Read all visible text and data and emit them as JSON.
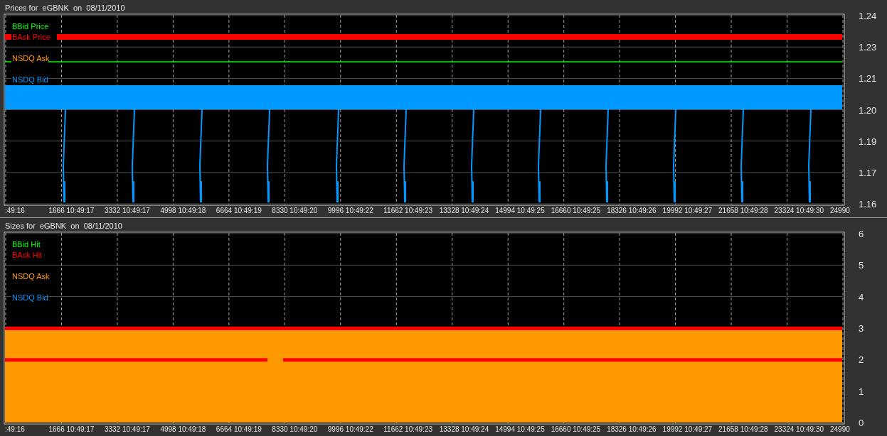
{
  "prices_panel": {
    "title": "Prices for  eGBNK  on  08/11/2010",
    "legend": [
      {
        "label": "BBid Price",
        "color": "#00ff00"
      },
      {
        "label": "BAsk Price",
        "color": "#ff0000"
      },
      {
        "label": "NSDQ Ask",
        "color": "#ff9900"
      },
      {
        "label": "NSDQ Bid",
        "color": "#0099ff"
      }
    ],
    "y_axis_labels": [
      "1.24",
      "1.23",
      "1.21",
      "1.20",
      "1.19",
      "1.17",
      "1.16"
    ],
    "x_axis_labels": [
      ":49:16",
      "1666 10:49:17",
      "3332 10:49:17",
      "4998 10:49:18",
      "6664 10:49:19",
      "8330 10:49:20",
      "9996 10:49:22",
      "11662 10:49:23",
      "13328 10:49:24",
      "14994 10:49:25",
      "16660 10:49:25",
      "18326 10:49:26",
      "19992 10:49:27",
      "21658 10:49:28",
      "23324 10:49:30",
      "24990"
    ]
  },
  "sizes_panel": {
    "title": "Sizes for  eGBNK  on  08/11/2010",
    "legend": [
      {
        "label": "BBid Hit",
        "color": "#00ff00"
      },
      {
        "label": "BAsk Hit",
        "color": "#ff0000"
      },
      {
        "label": "NSDQ Ask",
        "color": "#ff9900"
      },
      {
        "label": "NSDQ Bid",
        "color": "#0099ff"
      }
    ],
    "y_axis_labels": [
      "6",
      "5",
      "4",
      "3",
      "2",
      "1",
      "0"
    ],
    "x_axis_labels": [
      ":49:16",
      "1666 10:49:17",
      "3332 10:49:17",
      "4998 10:49:18",
      "6664 10:49:19",
      "8330 10:49:20",
      "9996 10:49:22",
      "11662 10:49:23",
      "13328 10:49:24",
      "14994 10:49:25",
      "16660 10:49:25",
      "18326 10:49:26",
      "19992 10:49:27",
      "21658 10:49:28",
      "23324 10:49:30",
      "24990"
    ]
  }
}
